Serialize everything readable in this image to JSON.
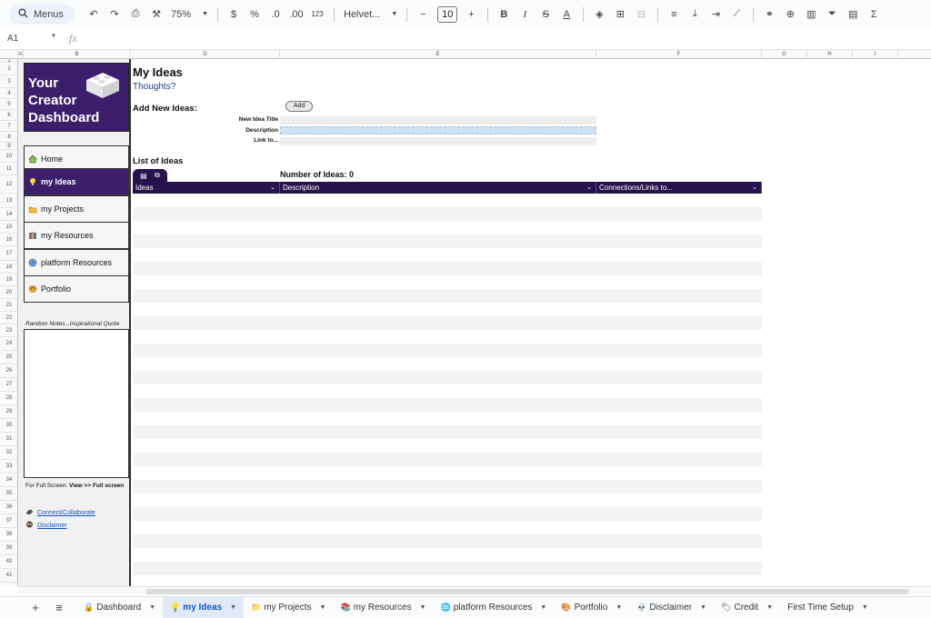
{
  "toolbar": {
    "menus_label": "Menus",
    "zoom": "75%",
    "currency": "$",
    "percent": "%",
    "dec_decrease": ".0",
    "dec_increase": ".00",
    "number_format": "123",
    "font": "Helvet...",
    "font_size": "10",
    "minus": "−",
    "plus": "+"
  },
  "formula_bar": {
    "cell_ref": "A1",
    "fx": "fx"
  },
  "columns": [
    "A",
    "B",
    "C",
    "D",
    "E",
    "F",
    "G",
    "H",
    "I"
  ],
  "rows": [
    "1",
    "2",
    "3",
    "4",
    "5",
    "6",
    "7",
    "8",
    "9",
    "10",
    "11",
    "12",
    "13",
    "14",
    "15",
    "16",
    "17",
    "18",
    "19",
    "20",
    "21",
    "22",
    "23",
    "24",
    "25",
    "26",
    "27",
    "28",
    "29",
    "30",
    "31",
    "32",
    "33",
    "34",
    "35",
    "36",
    "37",
    "38",
    "39",
    "40",
    "41"
  ],
  "sidebar": {
    "title_line1": "Your",
    "title_line2": "Creator",
    "title_line3": "Dashboard",
    "nav": [
      {
        "label": "Home",
        "icon": "house-icon"
      },
      {
        "label": "my Ideas",
        "icon": "lightbulb-icon"
      },
      {
        "label": "my Projects",
        "icon": "folder-icon"
      },
      {
        "label": "my Resources",
        "icon": "books-icon"
      },
      {
        "label": "platform Resources",
        "icon": "globe-icon"
      },
      {
        "label": "Portfolio",
        "icon": "palette-icon"
      }
    ],
    "notes_label": "Random Notes...Inspirational Quote",
    "fullscreen_prefix": "For Full Screen: ",
    "fullscreen_path": "View >> Full screen",
    "links": [
      {
        "label": "Connect/Collaborate",
        "icon": "handshake-icon"
      },
      {
        "label": "Disclaimer",
        "icon": "skull-icon"
      }
    ]
  },
  "main": {
    "title": "My Ideas",
    "subtitle": "Thoughts?",
    "add_heading": "Add New Ideas:",
    "add_button": "Add",
    "fields": {
      "title": "New Idea Title",
      "description": "Description",
      "link": "Link to..."
    },
    "list_heading": "List of Ideas",
    "count_label": "Number of Ideas: 0",
    "columns": [
      "Ideas",
      "Description",
      "Connections/Links to..."
    ]
  },
  "sheet_tabs": [
    {
      "label": "Dashboard",
      "icon": "lock-house-icon"
    },
    {
      "label": "my Ideas",
      "icon": "lightbulb-icon",
      "active": true
    },
    {
      "label": "my Projects",
      "icon": "folder-icon"
    },
    {
      "label": "my Resources",
      "icon": "books-icon"
    },
    {
      "label": "platform Resources",
      "icon": "globe-icon"
    },
    {
      "label": "Portfolio",
      "icon": "palette-icon"
    },
    {
      "label": "Disclaimer",
      "icon": "skull-icon"
    },
    {
      "label": "Credit",
      "icon": "tag-icon"
    },
    {
      "label": "First Time Setup",
      "icon": ""
    }
  ],
  "colors": {
    "accent": "#3b1f6d",
    "header": "#26134d",
    "link": "#1155cc"
  }
}
